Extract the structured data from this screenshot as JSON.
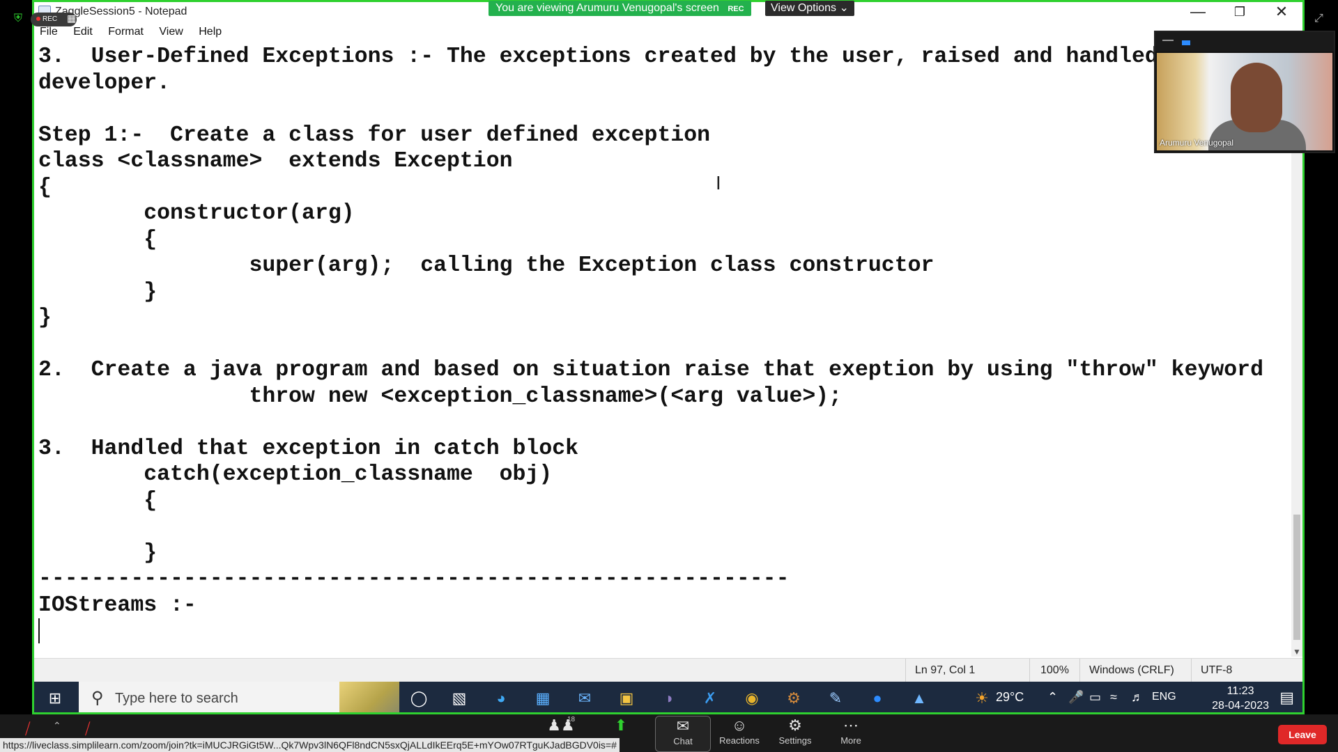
{
  "banner": {
    "viewing_text": "You are viewing Arumuru Venugopal's screen",
    "rec_label": "REC",
    "view_options_label": "View Options"
  },
  "overlay": {
    "rec_label": "REC"
  },
  "notepad": {
    "title": "ZaggleSession5 - Notepad",
    "menu": [
      "File",
      "Edit",
      "Format",
      "View",
      "Help"
    ],
    "content": "3.  User-Defined Exceptions :- The exceptions created by the user, raised and handled by the\ndeveloper.\n\nStep 1:-  Create a class for user defined exception\nclass <classname>  extends Exception\n{\n        constructor(arg)\n        {\n                super(arg);  calling the Exception class constructor\n        }\n}\n\n2.  Create a java program and based on situation raise that exeption by using \"throw\" keyword\n                throw new <exception_classname>(<arg value>);\n\n3.  Handled that exception in catch block\n        catch(exception_classname  obj)\n        {\n\n        }\n---------------------------------------------------------\nIOStreams :-\n",
    "status": {
      "position": "Ln 97, Col 1",
      "zoom": "100%",
      "line_ending": "Windows (CRLF)",
      "encoding": "UTF-8"
    }
  },
  "video": {
    "participant_name": "Arumuru Venugopal"
  },
  "taskbar": {
    "search_placeholder": "Type here to search",
    "temperature": "29°C",
    "language": "ENG",
    "time": "11:23",
    "date": "28-04-2023"
  },
  "zoom": {
    "participants_count": "18",
    "chat_label": "Chat",
    "reactions_label": "Reactions",
    "settings_label": "Settings",
    "more_label": "More",
    "leave_label": "Leave",
    "status_url": "https://liveclass.simplilearn.com/zoom/join?tk=iMUCJRGiGt5W...Qk7Wpv3lN6QFl8ndCN5sxQjALLdIkEErq5E+mYOw07RTguKJadBGDV0is=#"
  },
  "colors": {
    "share_border": "#2fd12f",
    "taskbar_bg": "#1c2a3f",
    "leave_red": "#e02828",
    "banner_green": "#23b14d"
  }
}
